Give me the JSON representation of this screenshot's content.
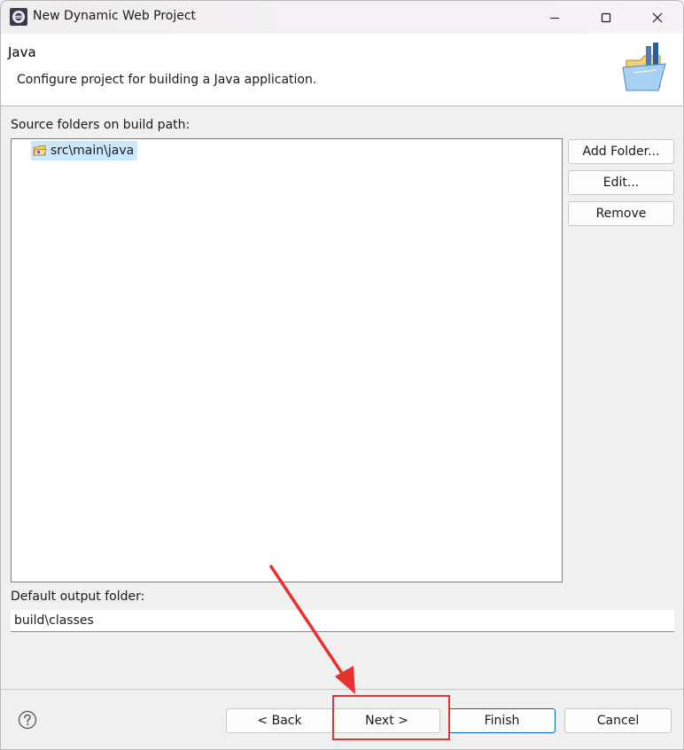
{
  "window": {
    "title": "New Dynamic Web Project",
    "minimize_icon": "minimize-icon",
    "maximize_icon": "maximize-icon",
    "close_icon": "close-icon"
  },
  "banner": {
    "title": "Java",
    "description": "Configure project for building a Java application."
  },
  "source_folders": {
    "label": "Source folders on build path:",
    "items": [
      {
        "label": "src\\main\\java",
        "icon": "source-folder-icon",
        "selected": true
      }
    ],
    "buttons": {
      "add": "Add Folder...",
      "edit": "Edit...",
      "remove": "Remove"
    }
  },
  "output": {
    "label": "Default output folder:",
    "value": "build\\classes"
  },
  "footer": {
    "back": "< Back",
    "next": "Next >",
    "finish": "Finish",
    "cancel": "Cancel"
  },
  "colors": {
    "selection": "#cce8ff",
    "default_button_border": "#0067c0",
    "annotation": "#e8312f"
  }
}
